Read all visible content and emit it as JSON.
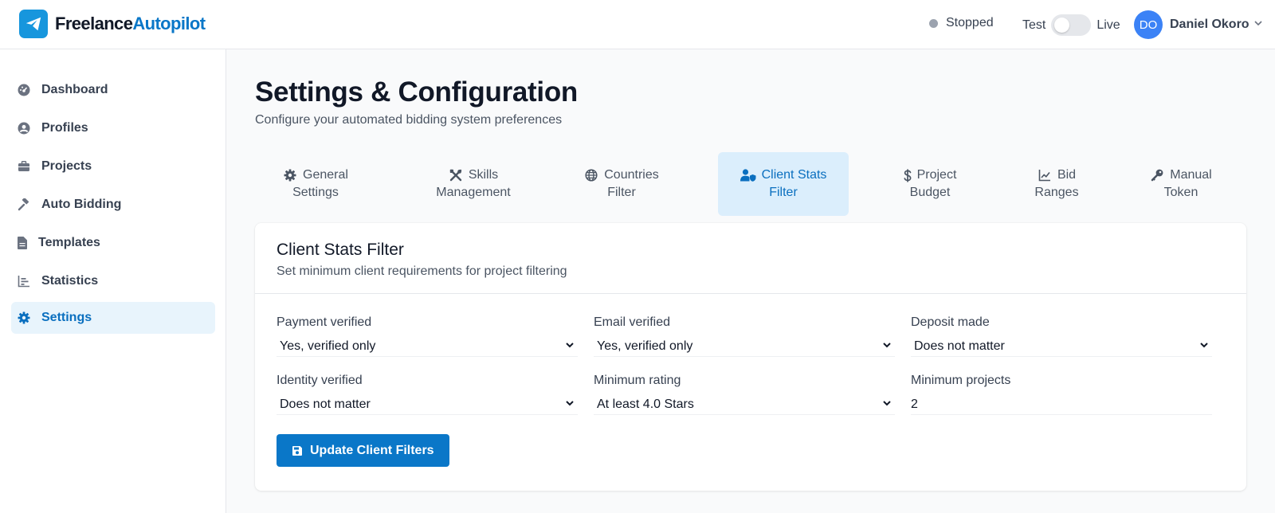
{
  "brand": {
    "name_part1": "Freelance",
    "name_part2": "Autopilot",
    "color": "#1796dd"
  },
  "header": {
    "status": "Stopped",
    "mode_test": "Test",
    "mode_live": "Live",
    "user_initials": "DO",
    "user_name": "Daniel Okoro"
  },
  "sidebar": {
    "items": [
      {
        "label": "Dashboard",
        "icon": "gauge-icon"
      },
      {
        "label": "Profiles",
        "icon": "user-circle-icon"
      },
      {
        "label": "Projects",
        "icon": "briefcase-icon"
      },
      {
        "label": "Auto Bidding",
        "icon": "gavel-icon"
      },
      {
        "label": "Templates",
        "icon": "file-icon"
      },
      {
        "label": "Statistics",
        "icon": "bar-chart-icon"
      },
      {
        "label": "Settings",
        "icon": "gear-icon",
        "active": true
      }
    ]
  },
  "page": {
    "title": "Settings & Configuration",
    "subtitle": "Configure your automated bidding system preferences"
  },
  "tabs": [
    {
      "line1": "General",
      "line2": "Settings",
      "icon": "gear-icon"
    },
    {
      "line1": "Skills",
      "line2": "Management",
      "icon": "tools-icon"
    },
    {
      "line1": "Countries",
      "line2": "Filter",
      "icon": "globe-icon"
    },
    {
      "line1": "Client Stats",
      "line2": "Filter",
      "icon": "user-shield-icon",
      "active": true
    },
    {
      "line1": "Project",
      "line2": "Budget",
      "icon": "dollar-icon"
    },
    {
      "line1": "Bid",
      "line2": "Ranges",
      "icon": "line-chart-icon"
    },
    {
      "line1": "Manual",
      "line2": "Token",
      "icon": "key-icon"
    }
  ],
  "card": {
    "title": "Client Stats Filter",
    "subtitle": "Set minimum client requirements for project filtering",
    "fields": {
      "payment_verified": {
        "label": "Payment verified",
        "value": "Yes, verified only"
      },
      "email_verified": {
        "label": "Email verified",
        "value": "Yes, verified only"
      },
      "deposit_made": {
        "label": "Deposit made",
        "value": "Does not matter"
      },
      "identity_verified": {
        "label": "Identity verified",
        "value": "Does not matter"
      },
      "minimum_rating": {
        "label": "Minimum rating",
        "value": "At least 4.0 Stars"
      },
      "minimum_projects": {
        "label": "Minimum projects",
        "value": "2"
      }
    },
    "button_label": "Update Client Filters"
  },
  "colors": {
    "accent": "#0a77c8",
    "active_tab_bg": "#dbeefc",
    "active_nav_bg": "#e8f4fc",
    "status_dot": "#9ca3af",
    "avatar": "#3b82f6"
  }
}
